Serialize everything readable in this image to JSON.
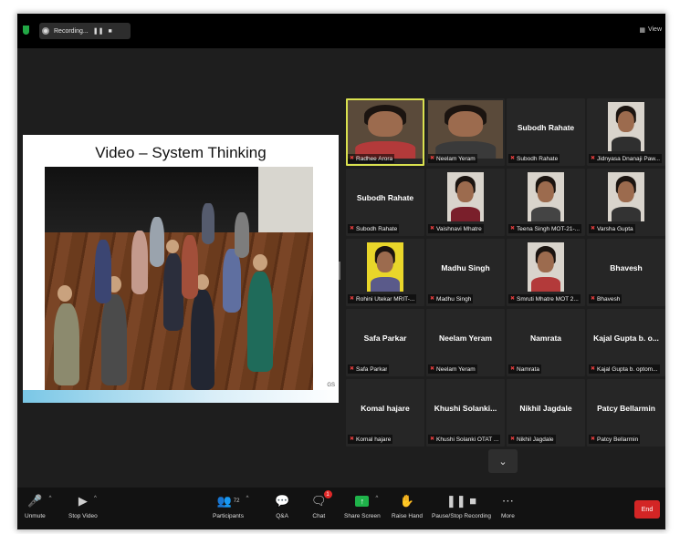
{
  "recording": {
    "label": "Recording...",
    "pause_icon": "pause-icon",
    "stop_icon": "stop-icon"
  },
  "view_button": {
    "label": "View"
  },
  "share": {
    "slide_title": "Video – System Thinking",
    "watermark": "GS"
  },
  "participants": [
    {
      "tile_name": "",
      "label": "Radhee Arora",
      "muted": true,
      "active": true,
      "camera": true,
      "wide": true
    },
    {
      "tile_name": "",
      "label": "Neelam Yeram",
      "muted": true,
      "camera": true,
      "wide": true
    },
    {
      "tile_name": "Subodh Rahate",
      "label": "Subodh Rahate",
      "muted": true
    },
    {
      "tile_name": "",
      "label": "Jidnyasa Dnanaji Paw...",
      "muted": true,
      "camera": true
    },
    {
      "tile_name": "Subodh Rahate",
      "label": "Subodh Rahate",
      "muted": true
    },
    {
      "tile_name": "",
      "label": "Vaishnavi Mhatre",
      "muted": true,
      "camera": true
    },
    {
      "tile_name": "",
      "label": "Teena Singh MOT-21-...",
      "muted": true,
      "camera": true
    },
    {
      "tile_name": "",
      "label": "Varsha Gupta",
      "muted": true,
      "camera": true
    },
    {
      "tile_name": "",
      "label": "Rohini Utekar MRIT-...",
      "muted": true,
      "camera": true,
      "yellow": true
    },
    {
      "tile_name": "Madhu Singh",
      "label": "Madhu Singh",
      "muted": true
    },
    {
      "tile_name": "",
      "label": "Smruti Mhatre MOT 2...",
      "muted": true,
      "camera": true
    },
    {
      "tile_name": "Bhavesh",
      "label": "Bhavesh",
      "muted": true
    },
    {
      "tile_name": "Safa Parkar",
      "label": "Safa Parkar",
      "muted": true
    },
    {
      "tile_name": "Neelam Yeram",
      "label": "Neelam Yeram",
      "muted": true
    },
    {
      "tile_name": "Namrata",
      "label": "Namrata",
      "muted": true
    },
    {
      "tile_name": "Kajal Gupta b. o...",
      "label": "Kajal Gupta b. optom...",
      "muted": true
    },
    {
      "tile_name": "Komal hajare",
      "label": "Komal hajare",
      "muted": true
    },
    {
      "tile_name": "Khushi Solanki...",
      "label": "Khushi Solanki OTAT ...",
      "muted": true
    },
    {
      "tile_name": "Nikhil Jagdale",
      "label": "Nikhil Jagdale",
      "muted": true
    },
    {
      "tile_name": "Patcy Bellarmin",
      "label": "Patcy Bellarmin",
      "muted": true
    }
  ],
  "toolbar": {
    "unmute": "Unmute",
    "stop_video": "Stop Video",
    "participants": "Participants",
    "participants_count": "72",
    "qa": "Q&A",
    "chat": "Chat",
    "chat_badge": "1",
    "share_screen": "Share Screen",
    "raise_hand": "Raise Hand",
    "pause_stop_recording": "Pause/Stop Recording",
    "more": "More",
    "end": "End"
  }
}
